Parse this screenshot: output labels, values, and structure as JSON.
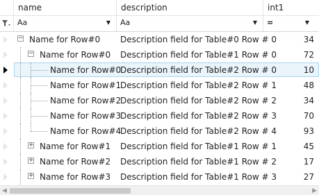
{
  "columns": [
    {
      "label": "name"
    },
    {
      "label": "description"
    },
    {
      "label": "int1"
    }
  ],
  "filter": {
    "text_op": "Aa",
    "num_op": "="
  },
  "rows": [
    {
      "name": "Name for Row#0",
      "description": "Description field for Table#0 Row # 0",
      "int1": "34",
      "level": 0,
      "expander": "minus"
    },
    {
      "name": "Name for Row#0",
      "description": "Description field for Table#1 Row # 0",
      "int1": "72",
      "level": 1,
      "expander": "minus"
    },
    {
      "name": "Name for Row#0",
      "description": "Description field for Table#2 Row # 0",
      "int1": "10",
      "level": 2,
      "expander": "",
      "selected": true
    },
    {
      "name": "Name for Row#1",
      "description": "Description field for Table#2 Row # 1",
      "int1": "48",
      "level": 2,
      "expander": ""
    },
    {
      "name": "Name for Row#2",
      "description": "Description field for Table#2 Row # 2",
      "int1": "34",
      "level": 2,
      "expander": ""
    },
    {
      "name": "Name for Row#3",
      "description": "Description field for Table#2 Row # 3",
      "int1": "70",
      "level": 2,
      "expander": ""
    },
    {
      "name": "Name for Row#4",
      "description": "Description field for Table#2 Row # 4",
      "int1": "93",
      "level": 2,
      "expander": ""
    },
    {
      "name": "Name for Row#1",
      "description": "Description field for Table#1 Row # 1",
      "int1": "45",
      "level": 1,
      "expander": "plus"
    },
    {
      "name": "Name for Row#2",
      "description": "Description field for Table#1 Row # 2",
      "int1": "17",
      "level": 1,
      "expander": "plus"
    },
    {
      "name": "Name for Row#3",
      "description": "Description field for Table#1 Row # 3",
      "int1": "27",
      "level": 1,
      "expander": "plus"
    }
  ],
  "icons": {
    "filter": "filter-icon",
    "scroll_left": "arrow-left-icon",
    "scroll_right": "arrow-right-icon"
  },
  "colors": {
    "selection_fill": "#e9f4fb",
    "selection_border": "#a9d3ee"
  }
}
